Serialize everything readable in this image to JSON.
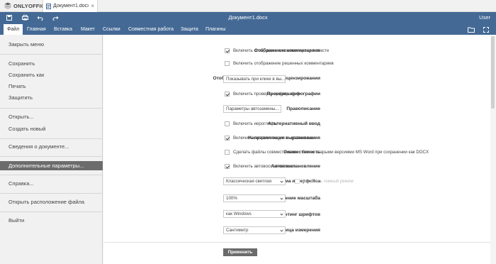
{
  "app": {
    "brand": "ONLYOFFICE",
    "tab_label": "Документ1.docx*",
    "title": "Документ1.docx",
    "user": "User"
  },
  "menu_tabs": [
    "Файл",
    "Главная",
    "Вставка",
    "Макет",
    "Ссылки",
    "Совместная работа",
    "Защита",
    "Плагины"
  ],
  "file_menu": {
    "items": [
      "Закрыть меню",
      "Сохранить",
      "Сохранить как",
      "Печать",
      "Защитить",
      "Открыть...",
      "Создать новый",
      "Сведения о документе...",
      "Дополнительные параметры...",
      "Справка...",
      "Открыть расположение файла",
      "Выйти"
    ],
    "active": "Дополнительные параметры..."
  },
  "settings": {
    "comments_label": "Отображение комментариев",
    "comments_show": "Включить отображение комментариев в тексте",
    "comments_resolved": "Включить отображение решенных комментариев",
    "review_label": "Отображение изменений при рецензировании",
    "review_value": "Показывать при клике в вы...",
    "spell_label": "Проверка орфографии",
    "spell_check": "Включить проверку орфографии",
    "proofing_label": "Правописание",
    "proofing_button": "Параметры автозамены...",
    "altinput_label": "Альтернативный ввод",
    "altinput_check": "Включить иероглифы",
    "guides_label": "Направляющие выравнивания",
    "guides_check": "Включить направляющие выравнивания",
    "compat_label": "Совместимость",
    "compat_check": "Сделать файлы совместимыми с более старыми версиями MS Word при сохранении как DOCX",
    "autorecover_label": "Автовосстановление",
    "autorecover_check": "Включить автовосстановление",
    "theme_label": "Тема интерфейса",
    "theme_value": "Классическая светлая",
    "dark_mode": "Включить темный режим",
    "zoom_label": "Стандартное значение масштаба",
    "zoom_value": "100%",
    "hinting_label": "Хинтинг шрифтов",
    "hinting_value": "как Windows",
    "unit_label": "Единица измерения",
    "unit_value": "Сантиметр",
    "apply": "Применить"
  },
  "icons": [
    "onlyoffice-logo",
    "document-icon",
    "save-icon",
    "print-icon",
    "undo-icon",
    "redo-icon",
    "open-location-icon",
    "expand-icon"
  ]
}
